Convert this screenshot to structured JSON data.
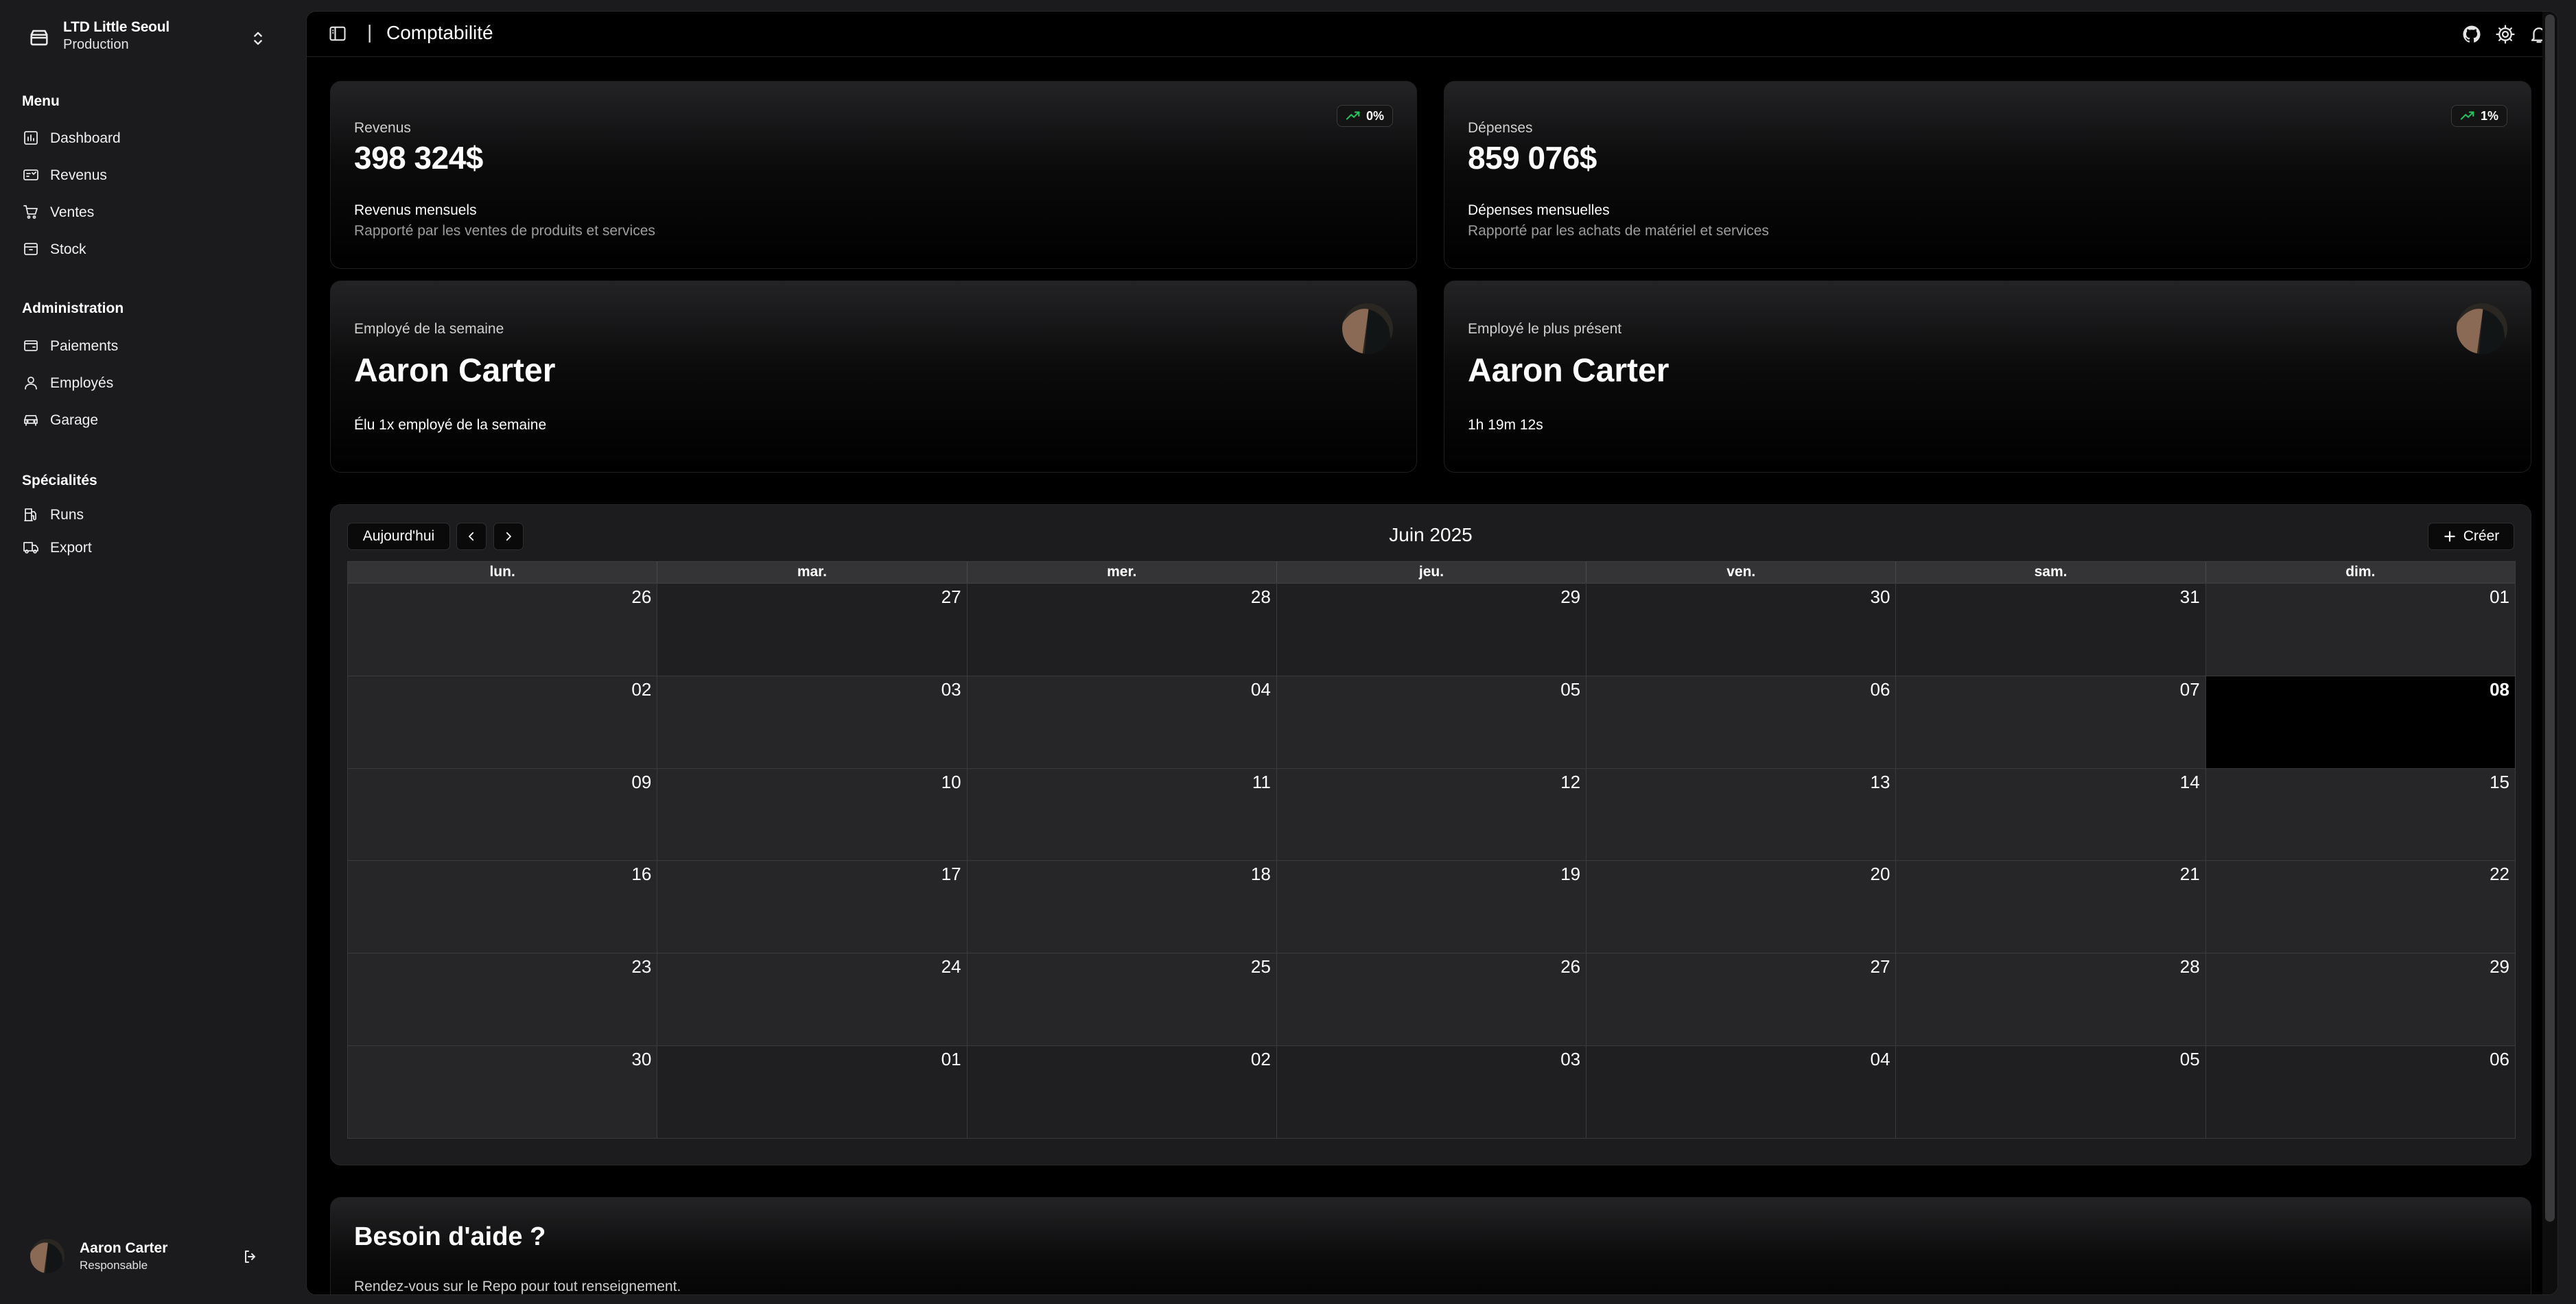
{
  "sidebar": {
    "org_name": "LTD Little Seoul",
    "org_env": "Production",
    "sections": {
      "menu": {
        "title": "Menu",
        "items": [
          {
            "label": "Dashboard",
            "icon": "dashboard-icon"
          },
          {
            "label": "Revenus",
            "icon": "revenue-icon"
          },
          {
            "label": "Ventes",
            "icon": "cart-icon"
          },
          {
            "label": "Stock",
            "icon": "box-icon"
          }
        ]
      },
      "admin": {
        "title": "Administration",
        "items": [
          {
            "label": "Paiements",
            "icon": "wallet-icon"
          },
          {
            "label": "Employés",
            "icon": "user-icon"
          },
          {
            "label": "Garage",
            "icon": "car-icon"
          }
        ]
      },
      "special": {
        "title": "Spécialités",
        "items": [
          {
            "label": "Runs",
            "icon": "fuel-icon"
          },
          {
            "label": "Export",
            "icon": "truck-icon"
          }
        ]
      }
    },
    "user": {
      "name": "Aaron Carter",
      "role": "Responsable"
    }
  },
  "topbar": {
    "separator": "|",
    "title": "Comptabilité",
    "icons": [
      "github-icon",
      "settings-icon",
      "bell-icon"
    ]
  },
  "cards": {
    "revenue": {
      "label": "Revenus",
      "value": "398 324$",
      "trend": "0%",
      "sub_title": "Revenus mensuels",
      "sub_desc": "Rapporté par les ventes de produits et services"
    },
    "expenses": {
      "label": "Dépenses",
      "value": "859 076$",
      "trend": "1%",
      "sub_title": "Dépenses mensuelles",
      "sub_desc": "Rapporté par les achats de matériel et services"
    },
    "employee_week": {
      "label": "Employé de la semaine",
      "name": "Aaron Carter",
      "note": "Élu 1x employé de la semaine"
    },
    "employee_present": {
      "label": "Employé le plus présent",
      "name": "Aaron Carter",
      "note": "1h 19m 12s"
    }
  },
  "calendar": {
    "today_button": "Aujourd'hui",
    "month_title": "Juin 2025",
    "create_button": "Créer",
    "weekdays": [
      "lun.",
      "mar.",
      "mer.",
      "jeu.",
      "ven.",
      "sam.",
      "dim."
    ],
    "weeks": [
      [
        "26",
        "27",
        "28",
        "29",
        "30",
        "31",
        "01"
      ],
      [
        "02",
        "03",
        "04",
        "05",
        "06",
        "07",
        "08"
      ],
      [
        "09",
        "10",
        "11",
        "12",
        "13",
        "14",
        "15"
      ],
      [
        "16",
        "17",
        "18",
        "19",
        "20",
        "21",
        "22"
      ],
      [
        "23",
        "24",
        "25",
        "26",
        "27",
        "28",
        "29"
      ],
      [
        "30",
        "01",
        "02",
        "03",
        "04",
        "05",
        "06"
      ]
    ],
    "today": "08"
  },
  "help": {
    "title": "Besoin d'aide ?",
    "text": "Rendez-vous sur le Repo pour tout renseignement."
  },
  "colors": {
    "app_bg": "#1b1b1d",
    "panel_bg": "#000000",
    "calendar_bg": "#1c1c1e",
    "trend_green": "#22c55e",
    "notif_red": "#ef4444"
  }
}
